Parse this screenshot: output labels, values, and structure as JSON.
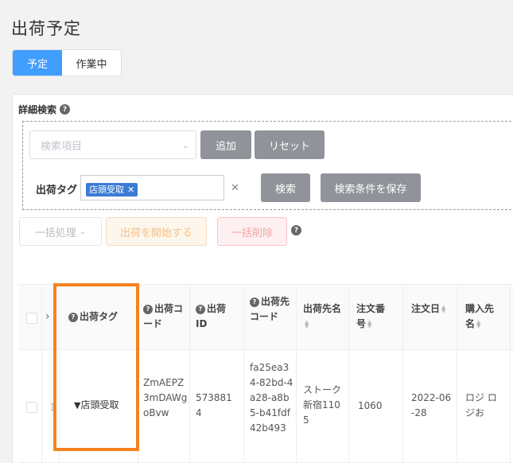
{
  "page": {
    "title": "出荷予定"
  },
  "tabs": [
    {
      "label": "予定",
      "active": true
    },
    {
      "label": "作業中",
      "active": false
    }
  ],
  "search": {
    "advanced_label": "詳細検索",
    "field_placeholder": "検索項目",
    "add_label": "追加",
    "reset_label": "リセット",
    "tag_label": "出荷タグ",
    "tag_chip": "店頭受取",
    "search_label": "検索",
    "save_label": "検索条件を保存"
  },
  "actions": {
    "bulk_label": "一括処理",
    "start_label": "出荷を開始する",
    "delete_label": "一括削除"
  },
  "table": {
    "headers": {
      "tag": "出荷タグ",
      "code": "出荷コード",
      "id": "出荷ID",
      "dest_code": "出荷先コード",
      "dest_name": "出荷先名",
      "order_no": "注文番号",
      "order_date": "注文日",
      "buyer": "購入先名"
    },
    "rows": [
      {
        "tag": "店頭受取",
        "code": "ZmAEPZ3mDAWgoBvw",
        "id": "5738814",
        "dest_code": "fa25ea34-82bd-4a28-a8b5-b41fdf42b493",
        "dest_name": "ストーク新宿1105",
        "order_no": "1060",
        "order_date": "2022-06-28",
        "buyer": "ロジ ロジお"
      }
    ]
  },
  "colors": {
    "primary": "#409eff",
    "highlight": "#f5821f",
    "chip": "#3a7bd5"
  },
  "icons": [
    "help-icon",
    "tag-icon",
    "chevron-down-icon",
    "close-icon",
    "sort-icon"
  ]
}
